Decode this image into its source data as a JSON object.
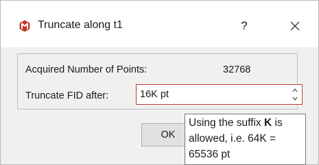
{
  "window": {
    "title": "Truncate along t1",
    "help_label": "?",
    "app_icon": "app-logo-icon",
    "close_icon": "close-icon",
    "accent_color": "#c0392b"
  },
  "form": {
    "points_label": "Acquired Number of Points:",
    "points_value": "32768",
    "truncate_label": "Truncate FID after:",
    "truncate_value": "16K pt"
  },
  "buttons": {
    "ok_label": "OK"
  },
  "tooltip": {
    "line1_prefix": "Using the suffix ",
    "line1_bold": "K",
    "line1_suffix": " is",
    "line2": "allowed, i.e. 64K =",
    "line3": "65536 pt"
  }
}
